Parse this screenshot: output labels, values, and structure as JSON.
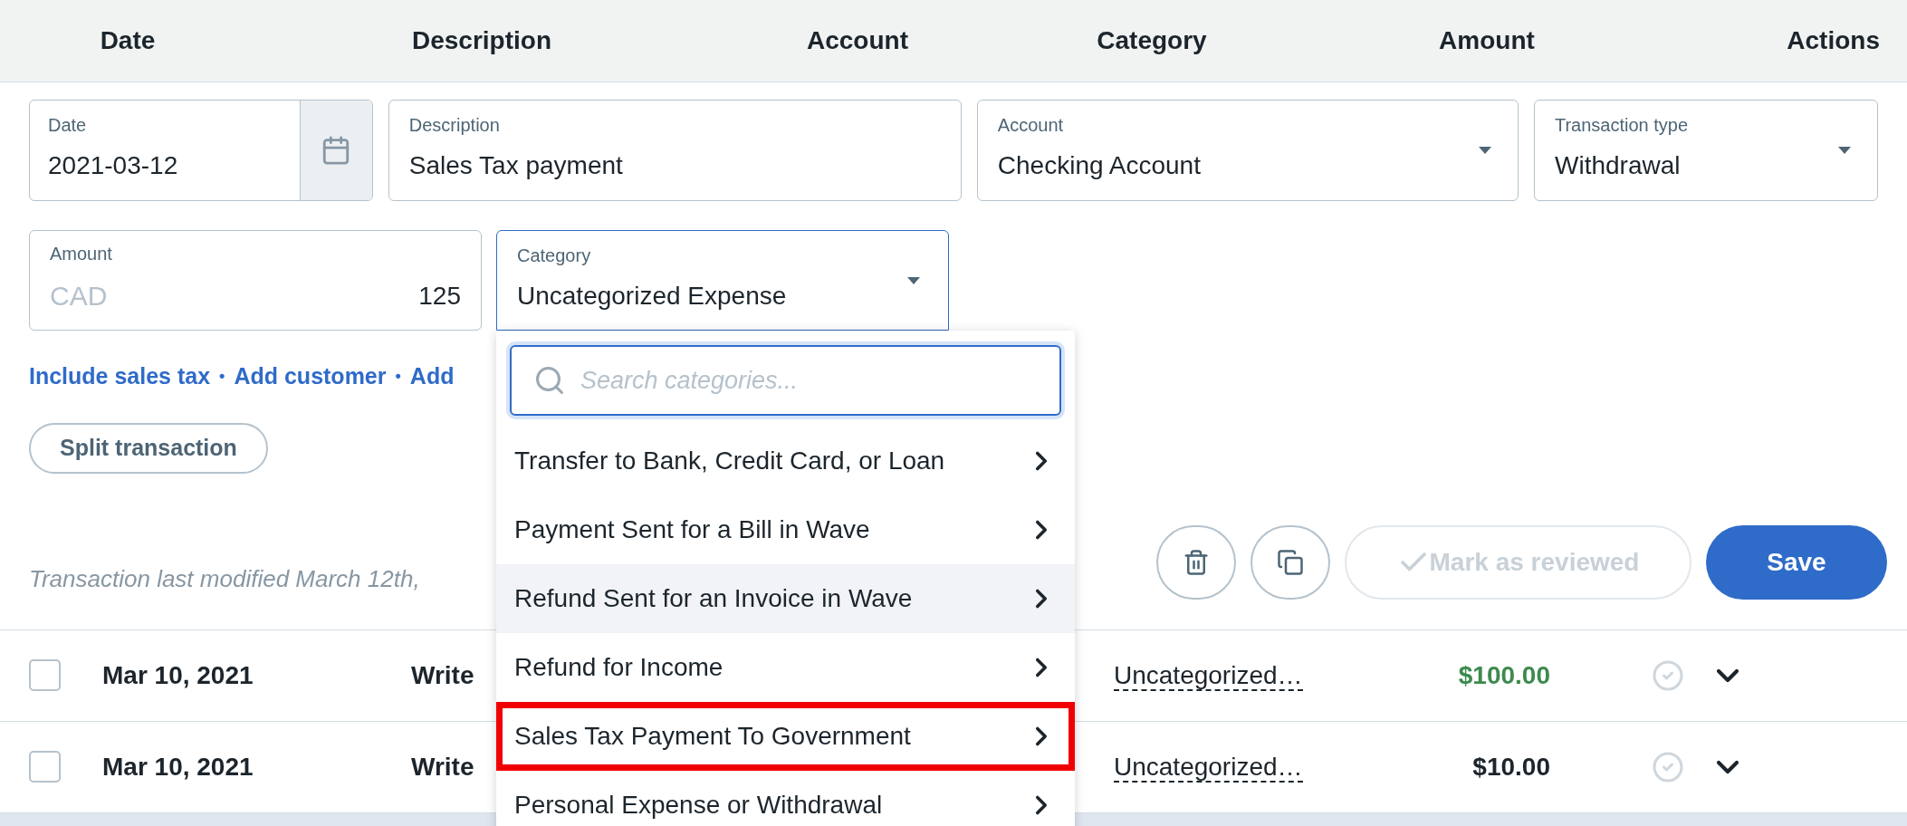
{
  "columns": [
    "Date",
    "Description",
    "Account",
    "Category",
    "Amount",
    "Actions"
  ],
  "form": {
    "date": {
      "label": "Date",
      "value": "2021-03-12"
    },
    "description": {
      "label": "Description",
      "value": "Sales Tax payment"
    },
    "account": {
      "label": "Account",
      "value": "Checking Account"
    },
    "transaction_type": {
      "label": "Transaction type",
      "value": "Withdrawal"
    },
    "amount": {
      "label": "Amount",
      "currency": "CAD",
      "value": "125"
    },
    "category": {
      "label": "Category",
      "value": "Uncategorized Expense",
      "focused": true
    },
    "links": [
      "Include sales tax",
      "Add customer",
      "Add"
    ],
    "separator": "•",
    "split_button": "Split transaction",
    "modified_note": "Transaction last modified March 12th,",
    "mark_reviewed": {
      "label": "Mark as reviewed",
      "disabled": true
    },
    "save_button": "Save"
  },
  "rows": [
    {
      "checked": false,
      "date": "Mar 10, 2021",
      "description": "Write",
      "category": "Uncategorized…",
      "amount": "$100.00",
      "color": "#3d8a4f"
    },
    {
      "checked": false,
      "date": "Mar 10, 2021",
      "description": "Write",
      "category": "Uncategorized…",
      "amount": "$10.00",
      "color": "#1c252c"
    }
  ],
  "dropdown": {
    "placeholder": "Search categories...",
    "items": [
      {
        "label": "Transfer to Bank, Credit Card, or Loan",
        "hovered": false,
        "outlined": false
      },
      {
        "label": "Payment Sent for a Bill in Wave",
        "hovered": false,
        "outlined": false
      },
      {
        "label": "Refund Sent for an Invoice in Wave",
        "hovered": true,
        "outlined": false
      },
      {
        "label": "Refund for Income",
        "hovered": false,
        "outlined": false
      },
      {
        "label": "Sales Tax Payment To Government",
        "hovered": false,
        "outlined": true
      },
      {
        "label": "Personal Expense or Withdrawal",
        "hovered": false,
        "outlined": false
      }
    ]
  }
}
